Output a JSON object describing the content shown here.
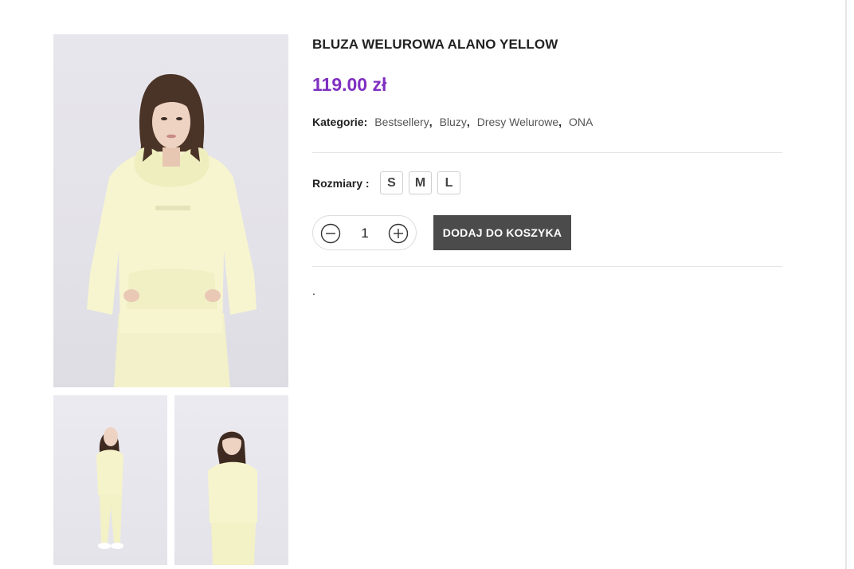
{
  "product": {
    "title": "BLUZA WELUROWA ALANO YELLOW",
    "price": "119.00 zł",
    "categories_label": "Kategorie:",
    "categories": [
      "Bestsellery",
      "Bluzy",
      "Dresy Welurowe",
      "ONA"
    ],
    "category_separator": ",",
    "sizes_label": "Rozmiary :",
    "sizes": [
      "S",
      "M",
      "L"
    ],
    "quantity": "1",
    "add_to_cart_label": "DODAJ DO KOSZYKA",
    "short_description": ".",
    "price_color": "#7f2fc1",
    "button_color": "#4b4b4b"
  },
  "gallery": {
    "main_image": "model-yellow-velour-hoodie-front",
    "thumbnails": [
      "model-yellow-velour-set-side",
      "model-yellow-velour-hoodie-back"
    ]
  },
  "icons": {
    "minus": "minus-circle-icon",
    "plus": "plus-circle-icon"
  }
}
